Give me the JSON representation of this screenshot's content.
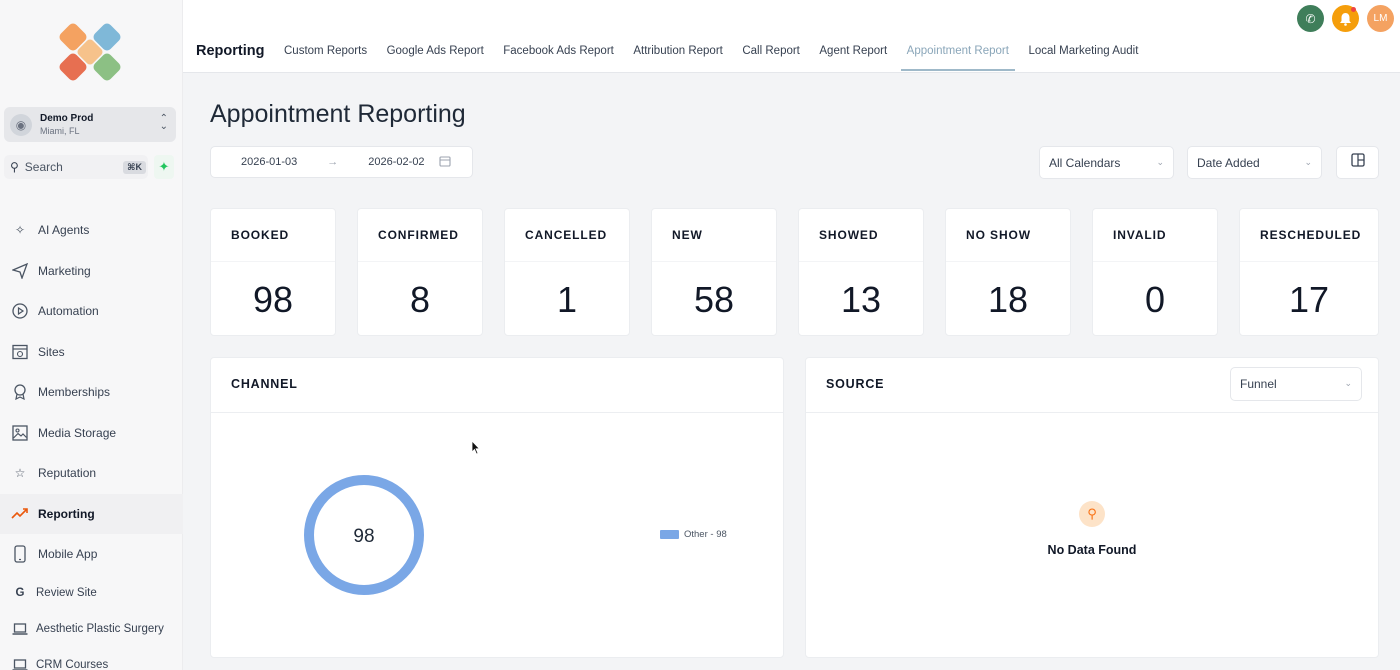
{
  "account": {
    "name": "Demo Prod",
    "location": "Miami, FL"
  },
  "search": {
    "label": "Search",
    "shortcut": "⌘K"
  },
  "sidebar": {
    "items": [
      {
        "label": "AI Agents",
        "icon": "sparkle-icon"
      },
      {
        "label": "Marketing",
        "icon": "send-icon"
      },
      {
        "label": "Automation",
        "icon": "play-circle-icon"
      },
      {
        "label": "Sites",
        "icon": "globe-window-icon"
      },
      {
        "label": "Memberships",
        "icon": "award-icon"
      },
      {
        "label": "Media Storage",
        "icon": "image-icon"
      },
      {
        "label": "Reputation",
        "icon": "star-icon"
      },
      {
        "label": "Reporting",
        "icon": "trend-icon",
        "active": true
      },
      {
        "label": "Mobile App",
        "icon": "phone-device-icon"
      },
      {
        "label": "Review Site",
        "icon": "google-g-icon"
      },
      {
        "label": "Aesthetic Plastic Surgery",
        "icon": "laptop-icon"
      },
      {
        "label": "CRM Courses",
        "icon": "laptop-icon"
      }
    ]
  },
  "header": {
    "section": "Reporting",
    "tabs": [
      {
        "label": "Custom Reports"
      },
      {
        "label": "Google Ads Report"
      },
      {
        "label": "Facebook Ads Report"
      },
      {
        "label": "Attribution Report"
      },
      {
        "label": "Call Report"
      },
      {
        "label": "Agent Report"
      },
      {
        "label": "Appointment Report",
        "active": true
      },
      {
        "label": "Local Marketing Audit"
      }
    ],
    "user_initials": "LM"
  },
  "page": {
    "title": "Appointment Reporting",
    "date_start": "2026-01-03",
    "date_end": "2026-02-02",
    "calendar_filter": "All Calendars",
    "date_filter": "Date Added"
  },
  "stats": [
    {
      "label": "BOOKED",
      "value": "98"
    },
    {
      "label": "CONFIRMED",
      "value": "8"
    },
    {
      "label": "CANCELLED",
      "value": "1"
    },
    {
      "label": "NEW",
      "value": "58"
    },
    {
      "label": "SHOWED",
      "value": "13"
    },
    {
      "label": "NO SHOW",
      "value": "18"
    },
    {
      "label": "INVALID",
      "value": "0"
    },
    {
      "label": "RESCHEDULED",
      "value": "17"
    }
  ],
  "channel": {
    "title": "CHANNEL",
    "total": "98",
    "legend": "Other - 98",
    "color": "#7aa7e6"
  },
  "source": {
    "title": "SOURCE",
    "filter": "Funnel",
    "empty_text": "No Data Found"
  },
  "colors": {
    "accent_tab": "#8aa6b9",
    "phone_button": "#3f7e5a",
    "bell_button": "#f59e0b",
    "avatar": "#f4a261"
  }
}
